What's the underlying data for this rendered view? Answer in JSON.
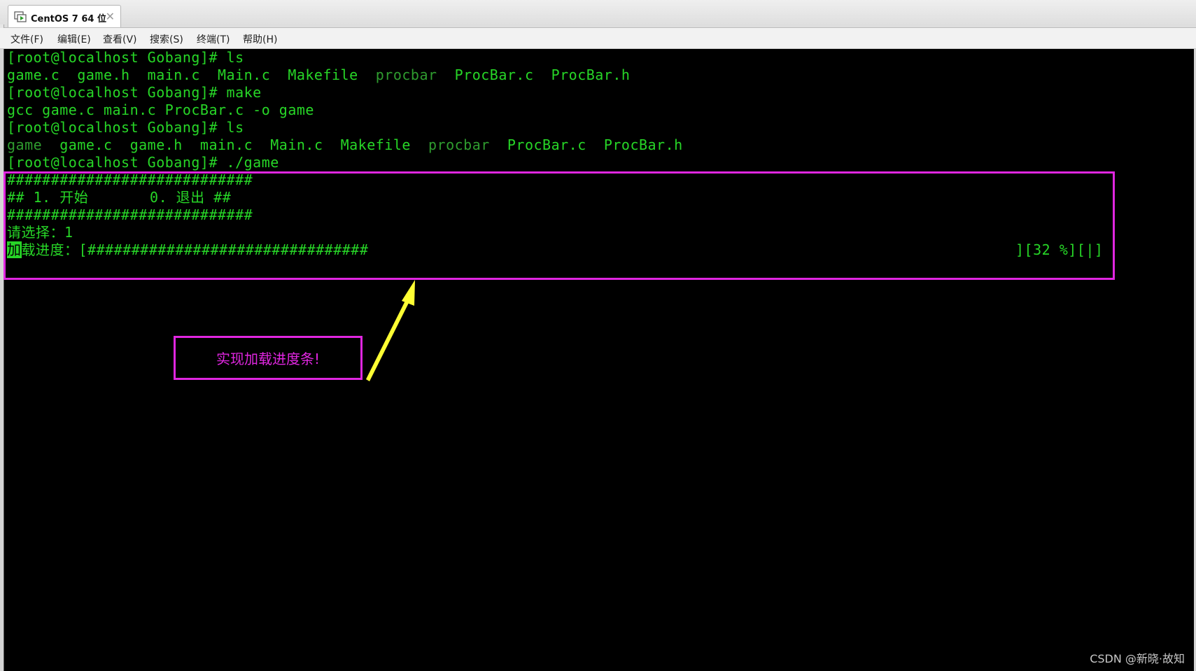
{
  "tab": {
    "label": "CentOS 7 64 位",
    "close_glyph": "✕",
    "icon": "vm-play-icon"
  },
  "menu": {
    "items": [
      "文件(F)",
      "编辑(E)",
      "查看(V)",
      "搜索(S)",
      "终端(T)",
      "帮助(H)"
    ]
  },
  "terminal": {
    "prompt": "[root@localhost Gobang]# ",
    "cmd1": "ls",
    "ls1": {
      "files_before": "game.c  game.h  main.c  Main.c  Makefile  ",
      "dim": "procbar",
      "files_after": "  ProcBar.c  ProcBar.h"
    },
    "cmd2": "make",
    "make_out": "gcc game.c main.c ProcBar.c -o game",
    "cmd3": "ls",
    "ls2": {
      "dim_first": "game",
      "files_mid": "  game.c  game.h  main.c  Main.c  Makefile  ",
      "dim": "procbar",
      "files_after": "  ProcBar.c  ProcBar.h"
    },
    "cmd4": "./game",
    "menu_border": "############################",
    "menu_line": "## 1. 开始       0. 退出 ##",
    "choose": "请选择：1",
    "bar_cursor": "加",
    "bar_label": "载进度：[",
    "bar_fill": "################################",
    "bar_tail": "][32 %][|]",
    "progress_percent": 32
  },
  "annotation": {
    "callout": "实现加载进度条!",
    "color": "#e026e0",
    "arrow_color": "#ffff33"
  },
  "watermark": "CSDN @新晓·故知"
}
